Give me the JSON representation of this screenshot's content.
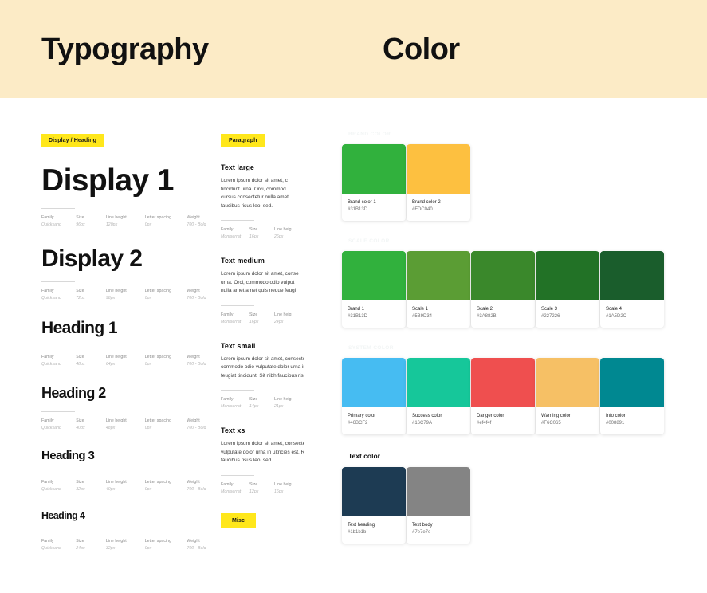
{
  "banner": {
    "typography_title": "Typography",
    "color_title": "Color"
  },
  "typography": {
    "chip_label": "Display / Heading",
    "spec_headers": {
      "family": "Family",
      "size": "Size",
      "line_height": "Line height",
      "letter_spacing": "Letter spacing",
      "weight": "Weight"
    },
    "specimens": [
      {
        "label": "Display 1",
        "family": "Quicksand",
        "size": "96px",
        "line_height": "120px",
        "letter_spacing": "0px",
        "weight": "700 - Bold"
      },
      {
        "label": "Display 2",
        "family": "Quicksand",
        "size": "72px",
        "line_height": "98px",
        "letter_spacing": "0px",
        "weight": "700 - Bold"
      },
      {
        "label": "Heading 1",
        "family": "Quicksand",
        "size": "48px",
        "line_height": "64px",
        "letter_spacing": "0px",
        "weight": "700 - Bold"
      },
      {
        "label": "Heading 2",
        "family": "Quicksand",
        "size": "40px",
        "line_height": "48px",
        "letter_spacing": "0px",
        "weight": "700 - Bold"
      },
      {
        "label": "Heading 3",
        "family": "Quicksand",
        "size": "32px",
        "line_height": "40px",
        "letter_spacing": "0px",
        "weight": "700 - Bold"
      },
      {
        "label": "Heading 4",
        "family": "Quicksand",
        "size": "24px",
        "line_height": "32px",
        "letter_spacing": "0px",
        "weight": "700 - Bold"
      }
    ]
  },
  "paragraph": {
    "chip_label": "Paragraph",
    "misc_chip_label": "Misc",
    "spec_headers": {
      "family": "Family",
      "size": "Size",
      "line_height": "Line heig"
    },
    "blocks": [
      {
        "title": "Text large",
        "lines": [
          "Lorem ipsum dolor sit amet, c",
          "tincidunt urna. Orci, commod",
          "cursus consectetur nulla amet",
          "faucibus risus leo, sed."
        ],
        "family": "Montserrat",
        "size": "16px",
        "line_height": "26px"
      },
      {
        "title": "Text medium",
        "lines": [
          "Lorem ipsum dolor sit amet, conse",
          "urna. Orci, commodo odio vulput",
          "nulla amet amet quis neque feugi"
        ],
        "family": "Montserrat",
        "size": "16px",
        "line_height": "24px"
      },
      {
        "title": "Text small",
        "lines": [
          "Lorem ipsum dolor sit amet, consectet",
          "commodo odio vulputate dolor urna in",
          "feugiat tincidunt. Sit nibh faucibus risu"
        ],
        "family": "Montserrat",
        "size": "14px",
        "line_height": "21px"
      },
      {
        "title": "Text xs",
        "lines": [
          "Lorem ipsum dolor sit amet, consectetur adip",
          "vulputate dolor urna in ultricies est. Risus cur",
          "faucibus risus leo, sed."
        ],
        "family": "Montserrat",
        "size": "12px",
        "line_height": "16px"
      }
    ]
  },
  "color": {
    "sections": [
      {
        "title": "Brand color",
        "faded": true,
        "swatches": [
          {
            "name": "Brand color 1",
            "hex": "#31B13D"
          },
          {
            "name": "Brand color 2",
            "hex": "#FDC040"
          }
        ]
      },
      {
        "title": "Scale color",
        "faded": true,
        "swatches": [
          {
            "name": "Brand 1",
            "hex": "#31B13D"
          },
          {
            "name": "Scale 1",
            "hex": "#5B9D34"
          },
          {
            "name": "Scale 2",
            "hex": "#3A882B"
          },
          {
            "name": "Scale 3",
            "hex": "#227226"
          },
          {
            "name": "Scale 4",
            "hex": "#1A5D2C"
          }
        ]
      },
      {
        "title": "System color",
        "faded": true,
        "swatches": [
          {
            "name": "Primary color",
            "hex": "#46BCF2"
          },
          {
            "name": "Success color",
            "hex": "#16C79A"
          },
          {
            "name": "Danger color",
            "hex": "#ef4f4f"
          },
          {
            "name": "Warning color",
            "hex": "#F6C065"
          },
          {
            "name": "Info color",
            "hex": "#008891"
          }
        ]
      },
      {
        "title": "Text color",
        "faded": false,
        "swatches": [
          {
            "name": "Text heading",
            "hex": "#1b1b1b",
            "display_hex": "#1D3B53"
          },
          {
            "name": "Text body",
            "hex": "#7e7e7e",
            "display_hex": "#848484"
          }
        ]
      }
    ]
  }
}
